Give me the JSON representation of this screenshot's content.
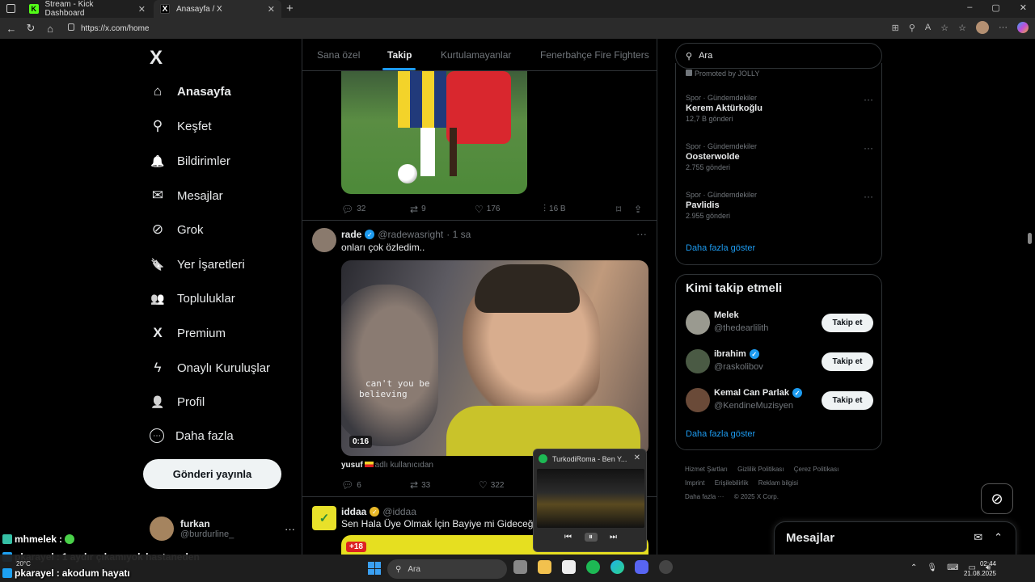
{
  "browser": {
    "tabs": [
      {
        "title": "Stream - Kick Dashboard",
        "favicon": "K",
        "active": false
      },
      {
        "title": "Anasayfa / X",
        "favicon": "X",
        "active": true
      }
    ],
    "new_tab": "+",
    "url": "https://x.com/home",
    "window_controls": [
      "–",
      "▢",
      "✕"
    ]
  },
  "nav": {
    "logo": "X",
    "items": [
      {
        "label": "Anasayfa",
        "icon": "home-icon",
        "glyph": "⌂"
      },
      {
        "label": "Keşfet",
        "icon": "search-icon",
        "glyph": "⚲"
      },
      {
        "label": "Bildirimler",
        "icon": "bell-icon",
        "glyph": "🔔"
      },
      {
        "label": "Mesajlar",
        "icon": "mail-icon",
        "glyph": "✉"
      },
      {
        "label": "Grok",
        "icon": "grok-icon",
        "glyph": "⊘"
      },
      {
        "label": "Yer İşaretleri",
        "icon": "bookmark-icon",
        "glyph": "🔖"
      },
      {
        "label": "Topluluklar",
        "icon": "communities-icon",
        "glyph": "👥"
      },
      {
        "label": "Premium",
        "icon": "x-premium-icon",
        "glyph": "X"
      },
      {
        "label": "Onaylı Kuruluşlar",
        "icon": "lightning-icon",
        "glyph": "ϟ"
      },
      {
        "label": "Profil",
        "icon": "person-icon",
        "glyph": "👤"
      },
      {
        "label": "Daha fazla",
        "icon": "more-circle-icon",
        "glyph": "⋯"
      }
    ],
    "post_button": "Gönderi yayınla",
    "profile": {
      "name": "furkan",
      "handle": "@burdurline_",
      "more": "···"
    }
  },
  "timeline": {
    "tabs": [
      "Sana özel",
      "Takip",
      "Kurtulamayanlar",
      "Fenerbahçe Fire Fighters"
    ],
    "active_tab": "Takip",
    "post1_actions": {
      "replies": "32",
      "reposts": "9",
      "likes": "176",
      "views": "16 B"
    },
    "post2": {
      "name": "rade",
      "handle": "@radewasright",
      "time": "· 1 sa",
      "text": "onları çok özledim..",
      "video_caption_line1": "can't you be",
      "video_caption_line2": "believing",
      "video_time": "0:16",
      "note_name": "yusuf",
      "note_text": "adlı kullanıcıdan",
      "actions": {
        "replies": "6",
        "reposts": "33",
        "likes": "322"
      }
    },
    "post3": {
      "name": "iddaa",
      "handle": "@iddaa",
      "text": "Sen Hala Üye Olmak İçin Bayiye mi Gideceğini S",
      "badge": "+18"
    }
  },
  "right": {
    "search_placeholder": "Ara",
    "promoted": "Promoted by JOLLY",
    "trends": [
      {
        "category": "Spor · Gündemdekiler",
        "title": "Kerem Aktürkoğlu",
        "count": "12,7 B gönderi"
      },
      {
        "category": "Spor · Gündemdekiler",
        "title": "Oosterwolde",
        "count": "2.755 gönderi"
      },
      {
        "category": "Spor · Gündemdekiler",
        "title": "Pavlidis",
        "count": "2.955 gönderi"
      }
    ],
    "show_more": "Daha fazla göster",
    "who_to_follow": {
      "title": "Kimi takip etmeli",
      "users": [
        {
          "name": "Melek",
          "handle": "@thedearlilith",
          "verified": false
        },
        {
          "name": "ibrahim",
          "handle": "@raskolibov",
          "verified": true
        },
        {
          "name": "Kemal Can Parlak",
          "handle": "@KendineMuzisyen",
          "verified": true
        }
      ],
      "follow_label": "Takip et",
      "show_more": "Daha fazla göster"
    },
    "footer": [
      "Hizmet Şartları",
      "Gizlilik Politikası",
      "Çerez Politikası",
      "Imprint",
      "Erişilebilirlik",
      "Reklam bilgisi",
      "Daha fazla ···",
      "© 2025 X Corp."
    ],
    "messages_title": "Mesajlar"
  },
  "mini_player": {
    "title": "TurkodiRoma - Ben Y...",
    "close": "✕"
  },
  "chat_overlay": [
    {
      "user": "mhmelek",
      "text": ""
    },
    {
      "user": "pkarayel",
      "text": "1 aydır çıkamıyok hastaneden"
    },
    {
      "user": "pkarayel",
      "text": "akodum hayatı"
    }
  ],
  "taskbar": {
    "search": "Ara",
    "time": "02:44",
    "date": "21.08.2025",
    "weather": "20°C"
  },
  "colors": {
    "accent": "#1d9bf0",
    "background": "#000000",
    "border": "#2f3336",
    "muted": "#71767b"
  }
}
